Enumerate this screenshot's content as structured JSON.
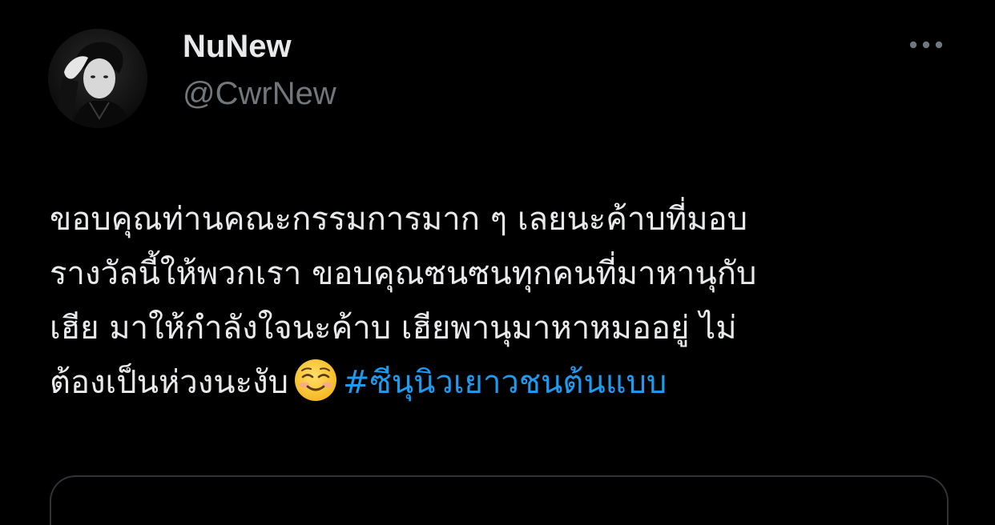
{
  "author": {
    "display_name": "NuNew",
    "handle": "@CwrNew"
  },
  "tweet": {
    "lines": [
      "ขอบคุณท่านคณะกรรมการมาก ๆ เลยนะค้าบที่มอบ",
      "รางวัลนี้ให้พวกเรา ขอบคุณซนซนทุกคนที่มาหานุกับ",
      "เฮีย มาให้กำลังใจนะค้าบ เฮียพานุมาหาหมออยู่ ไม่",
      "ต้องเป็นห่วงนะงับ"
    ],
    "emoji": "smiling-face-emoji",
    "hashtag": "#ซีนุนิวเยาวชนต้นแบบ"
  },
  "icons": {
    "more": "more-horizontal-icon"
  },
  "colors": {
    "background": "#000000",
    "text_primary": "#e7e9ea",
    "text_secondary": "#71767b",
    "accent_link": "#1d9bf0",
    "border": "#2f3336"
  }
}
